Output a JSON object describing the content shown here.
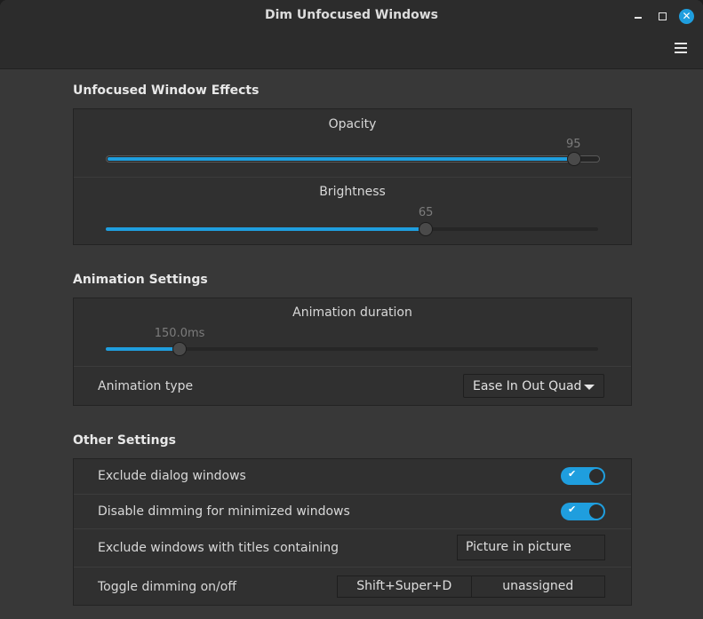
{
  "window": {
    "title": "Dim Unfocused Windows"
  },
  "sections": {
    "effects": {
      "title": "Unfocused Window Effects",
      "opacity": {
        "label": "Opacity",
        "value": "95",
        "fraction": 0.95
      },
      "brightness": {
        "label": "Brightness",
        "value": "65",
        "fraction": 0.65
      }
    },
    "animation": {
      "title": "Animation Settings",
      "duration": {
        "label": "Animation duration",
        "value": "150.0ms",
        "fraction": 0.15
      },
      "type": {
        "label": "Animation type",
        "selected": "Ease In Out Quad"
      }
    },
    "other": {
      "title": "Other Settings",
      "exclude_dialogs": {
        "label": "Exclude dialog windows",
        "enabled": true
      },
      "disable_minimized": {
        "label": "Disable dimming for minimized windows",
        "enabled": true
      },
      "exclude_titles": {
        "label": "Exclude windows with titles containing",
        "value": "Picture in picture"
      },
      "toggle_shortcut": {
        "label": "Toggle dimming on/off",
        "primary": "Shift+Super+D",
        "secondary": "unassigned"
      }
    }
  },
  "icons": {
    "close": "close-icon",
    "minimize": "minimize-icon",
    "maximize": "maximize-icon",
    "menu": "hamburger-menu-icon",
    "check": "checkmark-icon"
  },
  "colors": {
    "accent": "#1f9ede",
    "background": "#383838"
  }
}
